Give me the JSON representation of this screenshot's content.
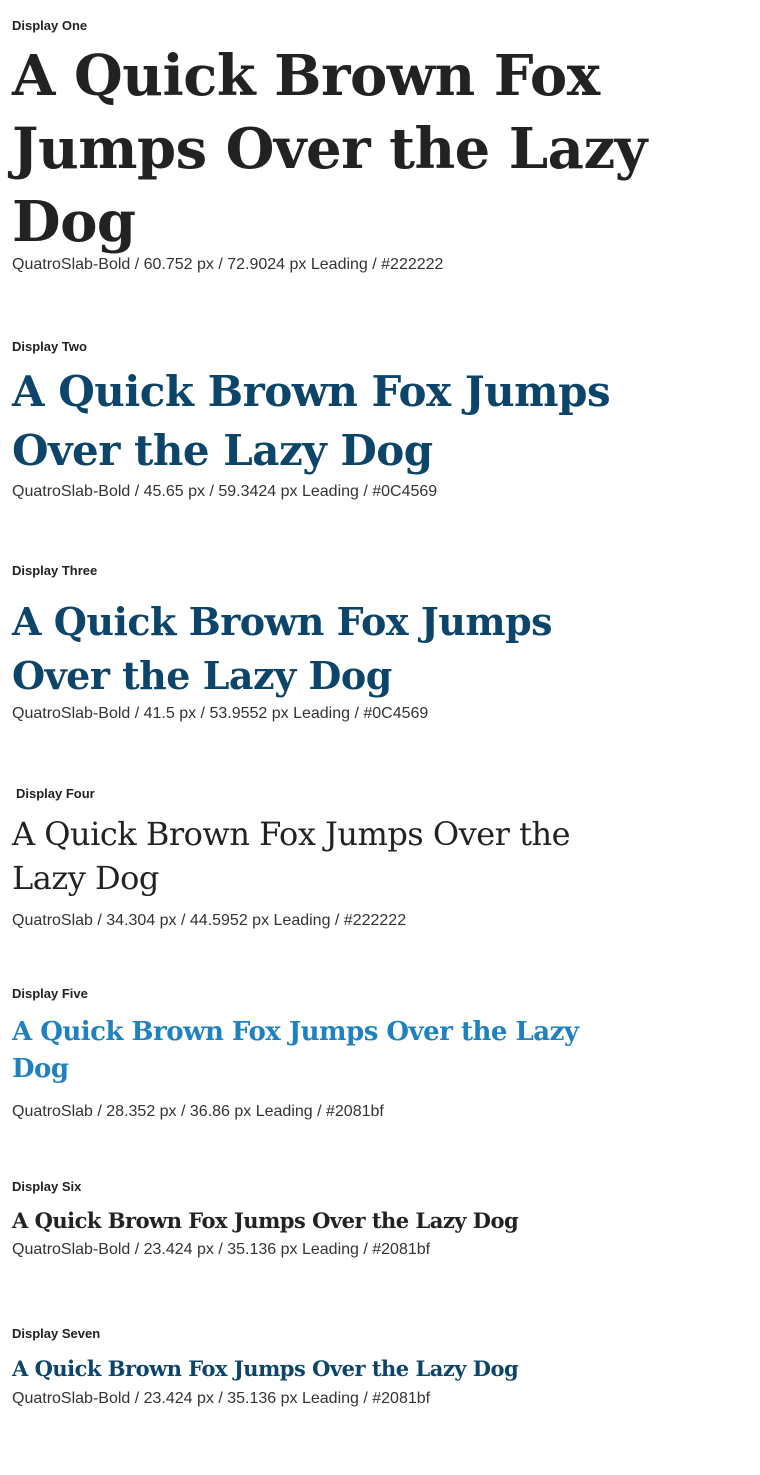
{
  "sections": [
    {
      "label": "Display One",
      "specimen": "A Quick Brown Fox Jumps Over the Lazy Dog",
      "meta": "QuatroSlab-Bold / 60.752 px / 72.9024 px Leading / #222222",
      "color": "#222222"
    },
    {
      "label": "Display Two",
      "specimen": "A Quick Brown Fox Jumps Over the Lazy Dog",
      "meta": "QuatroSlab-Bold / 45.65 px / 59.3424 px Leading / #0C4569",
      "color": "#0C4569"
    },
    {
      "label": "Display Three",
      "specimen": "A Quick Brown Fox Jumps Over the Lazy Dog",
      "meta": "QuatroSlab-Bold / 41.5 px / 53.9552 px Leading / #0C4569",
      "color": "#0C4569"
    },
    {
      "label": "Display Four",
      "specimen": "A Quick Brown Fox Jumps Over the Lazy Dog",
      "meta": "QuatroSlab / 34.304 px / 44.5952 px Leading / #222222",
      "color": "#222222"
    },
    {
      "label": "Display Five",
      "specimen": "A Quick Brown Fox Jumps Over the Lazy Dog",
      "meta": "QuatroSlab / 28.352 px / 36.86 px Leading / #2081bf",
      "color": "#2081bf"
    },
    {
      "label": "Display Six",
      "specimen": "A Quick Brown Fox Jumps Over the Lazy Dog",
      "meta": "QuatroSlab-Bold / 23.424 px / 35.136 px Leading / #2081bf",
      "color": "#222222"
    },
    {
      "label": "Display Seven",
      "specimen": "A Quick Brown Fox Jumps Over the Lazy Dog",
      "meta": "QuatroSlab-Bold / 23.424 px / 35.136 px Leading / #2081bf",
      "color": "#0C4569"
    }
  ]
}
